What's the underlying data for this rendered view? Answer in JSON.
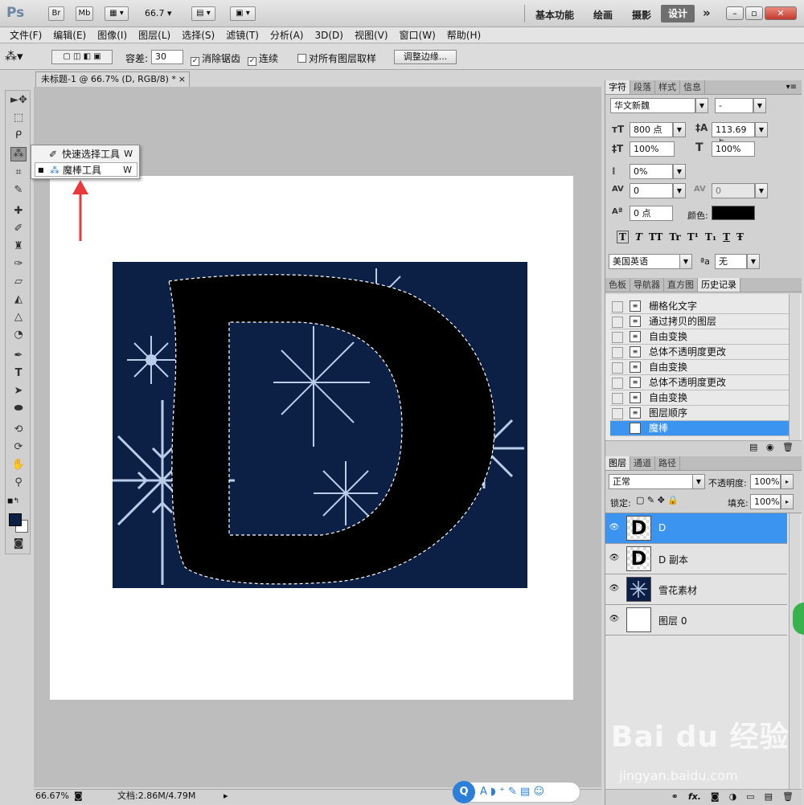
{
  "titlebar": {
    "logo": "Ps",
    "br": "Br",
    "mb": "Mb",
    "zoom": "66.7",
    "workspaces": [
      "基本功能",
      "绘画",
      "摄影"
    ],
    "active_workspace": "设计",
    "more": "»"
  },
  "menu": [
    "文件(F)",
    "编辑(E)",
    "图像(I)",
    "图层(L)",
    "选择(S)",
    "滤镜(T)",
    "分析(A)",
    "3D(D)",
    "视图(V)",
    "窗口(W)",
    "帮助(H)"
  ],
  "options": {
    "tolerance_label": "容差:",
    "tolerance_value": "30",
    "antialias_label": "消除锯齿",
    "contiguous_label": "连续",
    "sample_all_label": "对所有图层取样",
    "refine_edge_label": "调整边缘..."
  },
  "document": {
    "tab_title": "未标题-1 @ 66.7% (D, RGB/8) *",
    "tab_close": "×"
  },
  "flyout": [
    {
      "label": "快速选择工具",
      "key": "W"
    },
    {
      "label": "魔棒工具",
      "key": "W",
      "bullet": "■"
    }
  ],
  "statusbar": {
    "zoom": "66.67%",
    "doc_info": "文档:2.86M/4.79M"
  },
  "character_panel": {
    "tabs": [
      "字符",
      "段落",
      "样式",
      "信息"
    ],
    "font_family": "华文新魏",
    "font_style": "-",
    "font_size": "800 点",
    "leading": "113.69 点",
    "vscale": "100%",
    "hscale": "100%",
    "tracking_pct": "0%",
    "kerning": "0",
    "tracking": "0",
    "baseline": "0 点",
    "color_label": "颜色:",
    "color": "#000000",
    "style_buttons": [
      "T",
      "T",
      "TT",
      "Tr",
      "T¹",
      "T₁",
      "T",
      "Ŧ"
    ],
    "language": "美国英语",
    "aa_label": "ªa",
    "aa_value": "无"
  },
  "history_panel": {
    "tabs": [
      "色板",
      "导航器",
      "直方图",
      "历史记录"
    ],
    "items": [
      "栅格化文字",
      "通过拷贝的图层",
      "自由变换",
      "总体不透明度更改",
      "自由变换",
      "总体不透明度更改",
      "自由变换",
      "图层顺序",
      "魔棒"
    ],
    "active_index": 8
  },
  "layers_panel": {
    "tabs": [
      "图层",
      "通道",
      "路径"
    ],
    "blend_mode": "正常",
    "opacity_label": "不透明度:",
    "opacity_value": "100%",
    "lock_label": "锁定:",
    "fill_label": "填充:",
    "fill_value": "100%",
    "layers": [
      {
        "name": "D",
        "thumb_text": "D",
        "active": true
      },
      {
        "name": "D 副本",
        "thumb_text": "D",
        "active": false
      },
      {
        "name": "雪花素材",
        "thumb_text": "",
        "active": false
      },
      {
        "name": "图层 0",
        "thumb_text": "",
        "active": false
      }
    ],
    "footer_fx": "fx."
  },
  "watermark": {
    "text": "Bai du 经验",
    "url": "jingyan.baidu.com"
  },
  "colors": {
    "accent": "#3b94f0",
    "art_bg": "#0c1f45",
    "snow": "#b9cdea",
    "arrow": "#e83a3a"
  }
}
